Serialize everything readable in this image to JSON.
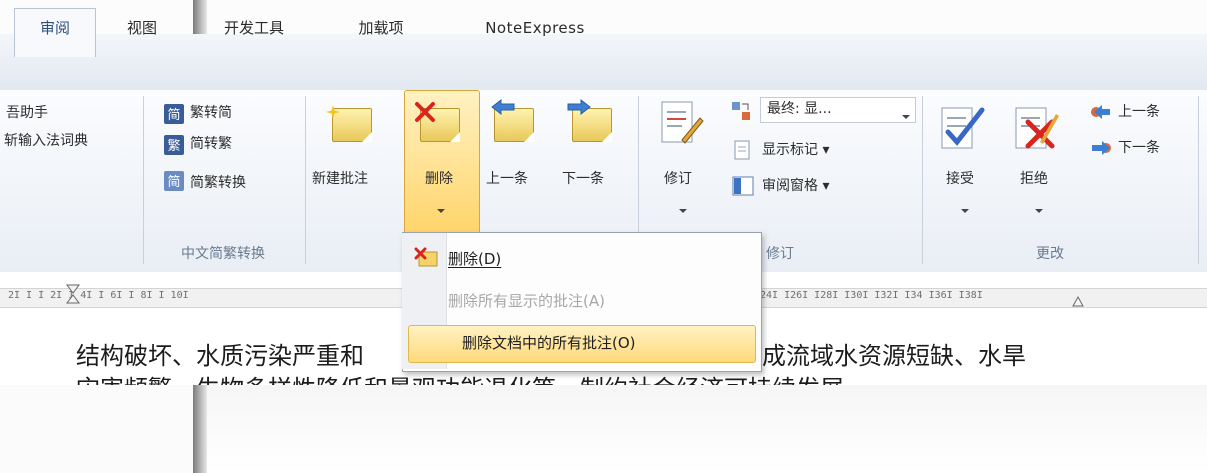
{
  "tabs": {
    "review": "审阅",
    "view": "视图",
    "developer": "开发工具",
    "addins": "加载项",
    "noteexpress": "NoteExpress"
  },
  "ribbon": {
    "left_cut": {
      "item1": "吾助手",
      "item2": "斩输入法词典"
    },
    "chinese_convert": {
      "to_simplified": "繁转简",
      "to_traditional": "简转繁",
      "convert": "简繁转换",
      "group_label": "中文简繁转换"
    },
    "comments": {
      "new_comment": "新建批注",
      "delete": "删除",
      "previous": "上一条",
      "next": "下一条"
    },
    "tracking": {
      "track_changes": "修订",
      "display_mode": "最终: 显...",
      "show_markup": "显示标记",
      "reviewing_pane": "审阅窗格",
      "group_label": "修订"
    },
    "changes": {
      "accept": "接受",
      "reject": "拒绝",
      "previous": "上一条",
      "next": "下一条",
      "group_label": "更改"
    }
  },
  "dropdown": {
    "delete_item": "删除(D)",
    "delete_shown": "删除所有显示的批注(A)",
    "delete_all": "删除文档中的所有批注(O)"
  },
  "ruler": {
    "left_ticks": "2I  I  I  2I  I 4I  I 6I  I 8I  I 10I",
    "right_ticks": "24I  I26I  I28I  I30I  I32I  I34  I36I  I38I"
  },
  "document": {
    "line1_left": "结构破坏、水质污染严重和",
    "line1_right": "成流域水资源短缺、水旱",
    "line2": "灾害频繁，生物多样性降低和景观功能退化等，制约社会经济可持续发展"
  },
  "colors": {
    "highlight": "#ffd97a",
    "ribbon_bg": "#e9eef5",
    "tab_text_active": "#2f4f7a"
  }
}
